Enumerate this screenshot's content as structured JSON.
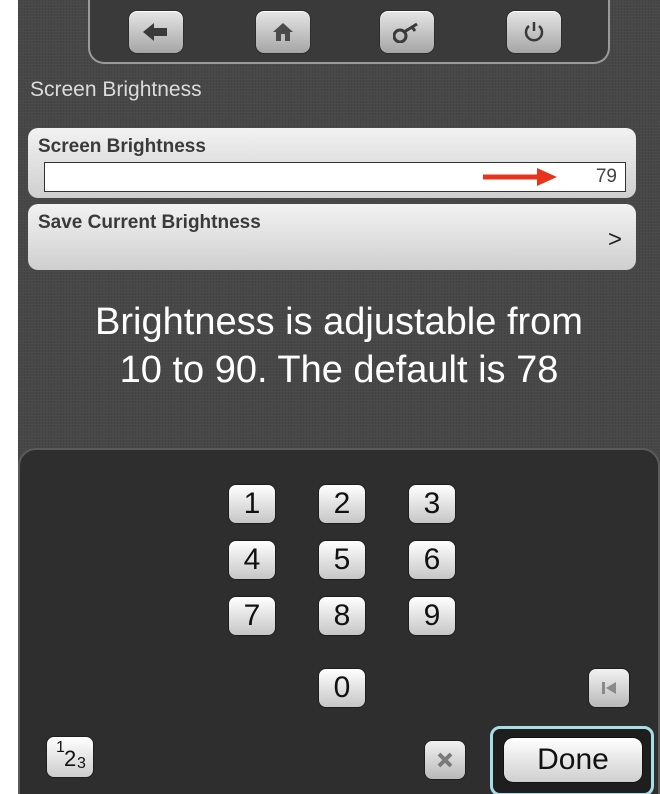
{
  "nav": {
    "buttons": [
      {
        "icon": "back-arrow-icon"
      },
      {
        "icon": "home-icon"
      },
      {
        "icon": "key-icon"
      },
      {
        "icon": "power-icon"
      }
    ]
  },
  "page_title": "Screen Brightness",
  "brightness_card": {
    "label": "Screen Brightness",
    "value": "79",
    "arrow_color": "#e8341c"
  },
  "save_card": {
    "label": "Save Current Brightness",
    "chevron": ">"
  },
  "info": {
    "line1": "Brightness is adjustable from",
    "line2": "10 to 90. The default is 78"
  },
  "keypad": {
    "keys": [
      "1",
      "2",
      "3",
      "4",
      "5",
      "6",
      "7",
      "8",
      "9",
      "0"
    ],
    "mode_sup": "1",
    "mode_mid": "2",
    "mode_sub": "3",
    "done_label": "Done",
    "highlight_color": "#a9dde6"
  }
}
